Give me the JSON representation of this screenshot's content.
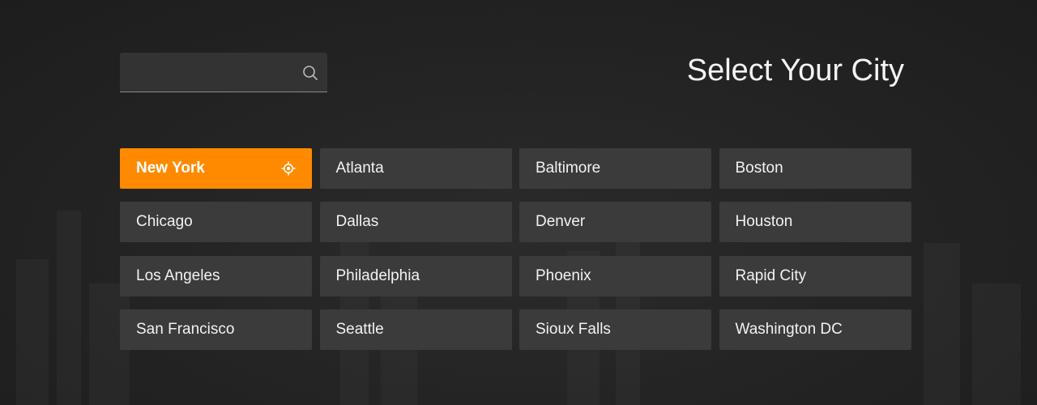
{
  "header": {
    "title": "Select Your City"
  },
  "search": {
    "value": "",
    "placeholder": "",
    "icon": "search-icon"
  },
  "cities": {
    "selected": "New York",
    "selected_icon": "location-target-icon",
    "accent_color": "#ff8a00",
    "items": [
      {
        "label": "New York"
      },
      {
        "label": "Atlanta"
      },
      {
        "label": "Baltimore"
      },
      {
        "label": "Boston"
      },
      {
        "label": "Chicago"
      },
      {
        "label": "Dallas"
      },
      {
        "label": "Denver"
      },
      {
        "label": "Houston"
      },
      {
        "label": "Los Angeles"
      },
      {
        "label": "Philadelphia"
      },
      {
        "label": "Phoenix"
      },
      {
        "label": "Rapid City"
      },
      {
        "label": "San Francisco"
      },
      {
        "label": "Seattle"
      },
      {
        "label": "Sioux Falls"
      },
      {
        "label": "Washington DC"
      }
    ]
  }
}
